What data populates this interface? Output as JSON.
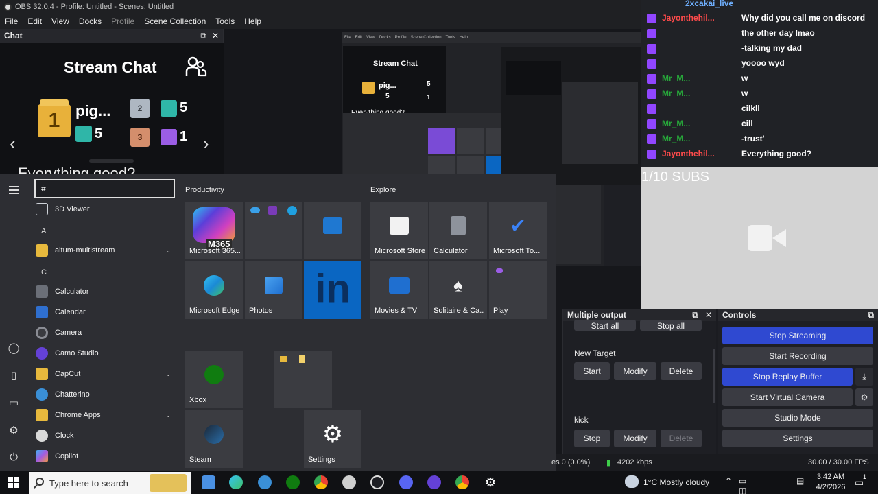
{
  "window": {
    "title": "OBS 32.0.4 - Profile: Untitled - Scenes: Untitled"
  },
  "menu": {
    "items": [
      "File",
      "Edit",
      "View",
      "Docks",
      "Profile",
      "Scene Collection",
      "Tools",
      "Help"
    ]
  },
  "chat_dock": {
    "title": "Chat",
    "heading": "Stream Chat",
    "leader_name": "pig...",
    "leader_rank": "1",
    "leader_gift_count": "5",
    "second_rank": "2",
    "second_gift_count": "5",
    "third_rank": "3",
    "third_gift_count": "1",
    "partial_message": "Everything good?"
  },
  "nested_preview": {
    "menu_items": [
      "File",
      "Edit",
      "View",
      "Docks",
      "Profile",
      "Scene Collection",
      "Tools",
      "Help"
    ],
    "chat_heading": "Stream Chat",
    "name": "pig...",
    "count_a": "5",
    "count_b": "5",
    "count_c": "1",
    "partial": "Everything good?"
  },
  "start_menu": {
    "search_value": "#",
    "apps": [
      {
        "label": "3D Viewer",
        "color": "#cfd3d9",
        "expandable": false
      },
      {
        "label": "aitum-multistream",
        "color": "#e7b93d",
        "expandable": true
      },
      {
        "label": "Calculator",
        "color": "#6b6f78",
        "expandable": false
      },
      {
        "label": "Calendar",
        "color": "#2f6fcf",
        "expandable": false
      },
      {
        "label": "Camera",
        "color": "#2a2b30",
        "expandable": false
      },
      {
        "label": "Camo Studio",
        "color": "#6441d6",
        "expandable": false
      },
      {
        "label": "CapCut",
        "color": "#e7b93d",
        "expandable": true
      },
      {
        "label": "Chatterino",
        "color": "#3a8fd6",
        "expandable": false
      },
      {
        "label": "Chrome Apps",
        "color": "#e7b93d",
        "expandable": true
      },
      {
        "label": "Clock",
        "color": "#d9d9d9",
        "expandable": false
      },
      {
        "label": "Copilot",
        "color": "#a35be0",
        "expandable": false
      }
    ],
    "letters": [
      "A",
      "C"
    ],
    "productivity_title": "Productivity",
    "explore_title": "Explore",
    "tiles": {
      "m365": "Microsoft 365...",
      "m365_badge": "M365",
      "edge": "Microsoft Edge",
      "photos": "Photos",
      "store": "Microsoft Store",
      "calculator": "Calculator",
      "todo": "Microsoft To...",
      "movies": "Movies & TV",
      "solitaire": "Solitaire & Ca...",
      "play": "Play",
      "xbox": "Xbox",
      "steam": "Steam",
      "settings": "Settings",
      "linkedin": "in"
    }
  },
  "overlay_chat": {
    "header_name": "2xcakai_live",
    "rows": [
      {
        "name": "Jayonthehil...",
        "name_color": "#ff4b4b",
        "message": "Why did you call me on discord"
      },
      {
        "name": "",
        "name_color": "#ffffff",
        "message": "the other day lmao"
      },
      {
        "name": "",
        "name_color": "#ffffff",
        "message": "-talking my dad"
      },
      {
        "name": "",
        "name_color": "#ffffff",
        "message": "yoooo wyd"
      },
      {
        "name": "Mr_M...",
        "name_color": "#27a83a",
        "message": "w"
      },
      {
        "name": "Mr_M...",
        "name_color": "#27a83a",
        "message": "w"
      },
      {
        "name": "",
        "name_color": "#ffffff",
        "message": "cilkll"
      },
      {
        "name": "Mr_M...",
        "name_color": "#27a83a",
        "message": "cill"
      },
      {
        "name": "Mr_M...",
        "name_color": "#27a83a",
        "message": "-trust'"
      },
      {
        "name": "Jayonthehil...",
        "name_color": "#ff4b4b",
        "message": "Everything good?"
      }
    ],
    "subs_goal": "1/10 SUBS"
  },
  "multiple_output": {
    "title": "Multiple output",
    "start_all": "Start all",
    "stop_all": "Stop all",
    "target1_name": "New Target",
    "target1_start": "Start",
    "target1_modify": "Modify",
    "target1_delete": "Delete",
    "target2_name": "kick",
    "target2_stop": "Stop",
    "target2_modify": "Modify",
    "target2_delete": "Delete"
  },
  "controls": {
    "title": "Controls",
    "stop_streaming": "Stop Streaming",
    "start_recording": "Start Recording",
    "stop_replay_buffer": "Stop Replay Buffer",
    "start_virtual_camera": "Start Virtual Camera",
    "studio_mode": "Studio Mode",
    "settings": "Settings"
  },
  "status_bar": {
    "dropped": "es 0 (0.0%)",
    "bitrate": "4202 kbps",
    "fps": "30.00 / 30.00 FPS"
  },
  "taskbar": {
    "search_placeholder": "Type here to search",
    "weather": "1°C  Mostly cloudy",
    "time": "3:42 AM",
    "date": "4/2/2026",
    "notification_count": "1"
  },
  "colors": {
    "accent_blue": "#2f49d1",
    "dock_bg": "#1e1f24",
    "start_menu_bg": "#2d2e33"
  }
}
